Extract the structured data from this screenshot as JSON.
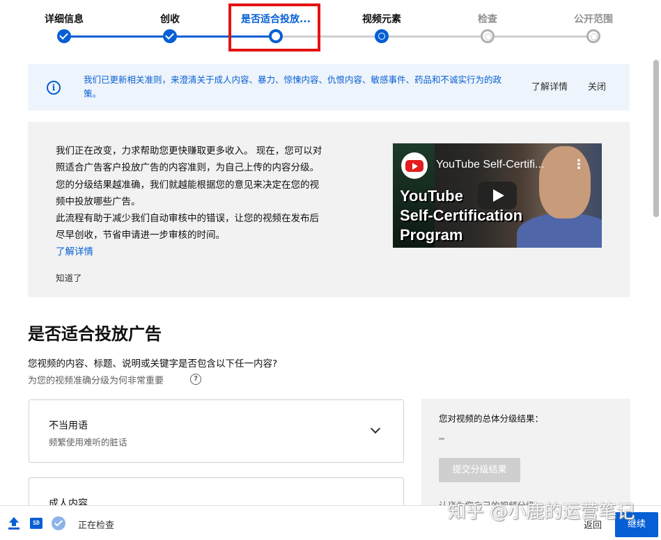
{
  "stepper": {
    "steps": [
      {
        "label": "详细信息",
        "state": "done"
      },
      {
        "label": "创收",
        "state": "done"
      },
      {
        "label": "是否适合投放...",
        "state": "current"
      },
      {
        "label": "视频元素",
        "state": "next"
      },
      {
        "label": "检查",
        "state": "future"
      },
      {
        "label": "公开范围",
        "state": "future"
      }
    ]
  },
  "banner": {
    "icon": "info-icon",
    "message": "我们已更新相关准则，来澄清关于成人内容、暴力、惊悚内容、仇恨内容、敏感事件、药品和不诚实行为的政策。",
    "learn_more": "了解详情",
    "close": "关闭"
  },
  "promo": {
    "body_lines": [
      "我们正在改变，力求帮助您更快赚取更多收入。 现在，您可以对",
      "照适合广告客户投放广告的内容准则，为自己上传的内容分级。",
      "您的分级结果越准确，我们就越能根据您的意见来决定在您的视",
      "频中投放哪些广告。",
      "此流程有助于减少我们自动审核中的错误，让您的视频在发布后",
      "尽早创收，节省申请进一步审核的时间。"
    ],
    "learn_more": "了解详情",
    "dismiss": "知道了",
    "video": {
      "title": "YouTube Self-Certifi...",
      "overlay_lines": [
        "YouTube",
        "Self-Certification",
        "Program"
      ]
    }
  },
  "section": {
    "title": "是否适合投放广告",
    "question": "您视频的内容、标题、说明或关键字是否包含以下任一内容?",
    "why": "为您的视频准确分级为何非常重要"
  },
  "categories": [
    {
      "title": "不当用语",
      "desc": "频繁使用难听的脏话"
    },
    {
      "title": "成人内容",
      "desc": ""
    }
  ],
  "rating": {
    "label": "您对视频的总体分级结果：",
    "value": "–",
    "submit": "提交分级结果",
    "more": "认真为您自己的视频分级"
  },
  "footer": {
    "status": "正在检查",
    "sd_badge": "SD",
    "back": "返回",
    "continue": "继续",
    "watermark": "知乎 @小鹿的运营笔记"
  },
  "colors": {
    "accent": "#065fd4",
    "highlight": "#e31212",
    "banner_bg": "#eef4fb",
    "card_bg": "#f2f2f2"
  }
}
